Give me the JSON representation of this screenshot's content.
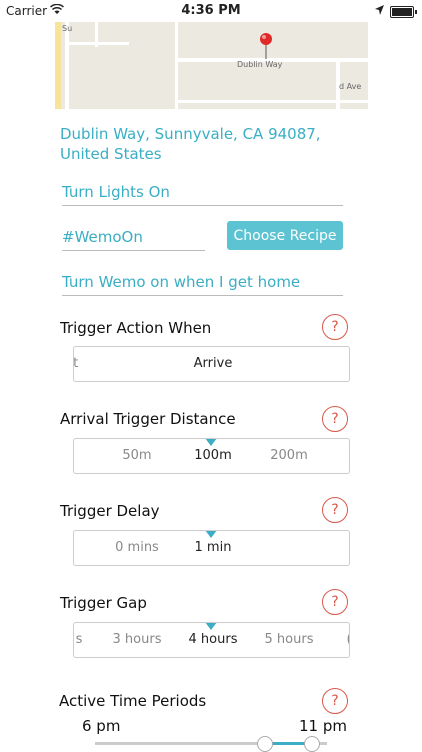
{
  "status_bar": {
    "carrier": "Carrier",
    "time": "4:36 PM"
  },
  "map": {
    "street_1": "Dublin Way",
    "street_2": "Su",
    "street_3": "d Ave"
  },
  "address": "Dublin Way, Sunnyvale, CA  94087, United States",
  "form": {
    "name_value": "Turn Lights On",
    "hashtag_value": "#WemoOn",
    "choose_recipe_label": "Choose Recipe",
    "description_value": "Turn Wemo on when I get home"
  },
  "sections": {
    "trigger_action": {
      "title": "Trigger Action When",
      "options": [
        "rt",
        "Arrive"
      ],
      "selected": "Arrive"
    },
    "arrival_distance": {
      "title": "Arrival Trigger Distance",
      "options": [
        "50m",
        "100m",
        "200m"
      ],
      "selected": "100m"
    },
    "trigger_delay": {
      "title": "Trigger Delay",
      "options": [
        "0 mins",
        "1 min"
      ],
      "selected": "1 min"
    },
    "trigger_gap": {
      "title": "Trigger Gap",
      "options": [
        "s",
        "3 hours",
        "4 hours",
        "5 hours",
        "("
      ],
      "selected": "4 hours"
    },
    "active_time": {
      "title": "Active Time Periods",
      "start": "6 pm",
      "end": "11 pm"
    }
  },
  "help_label": "?",
  "colors": {
    "accent": "#3aaec4",
    "help": "#d9584a",
    "button": "#5bc3d1"
  },
  "icons": [
    "wifi-icon",
    "location-arrow-icon",
    "battery-icon",
    "map-pin-icon",
    "help-icon"
  ]
}
